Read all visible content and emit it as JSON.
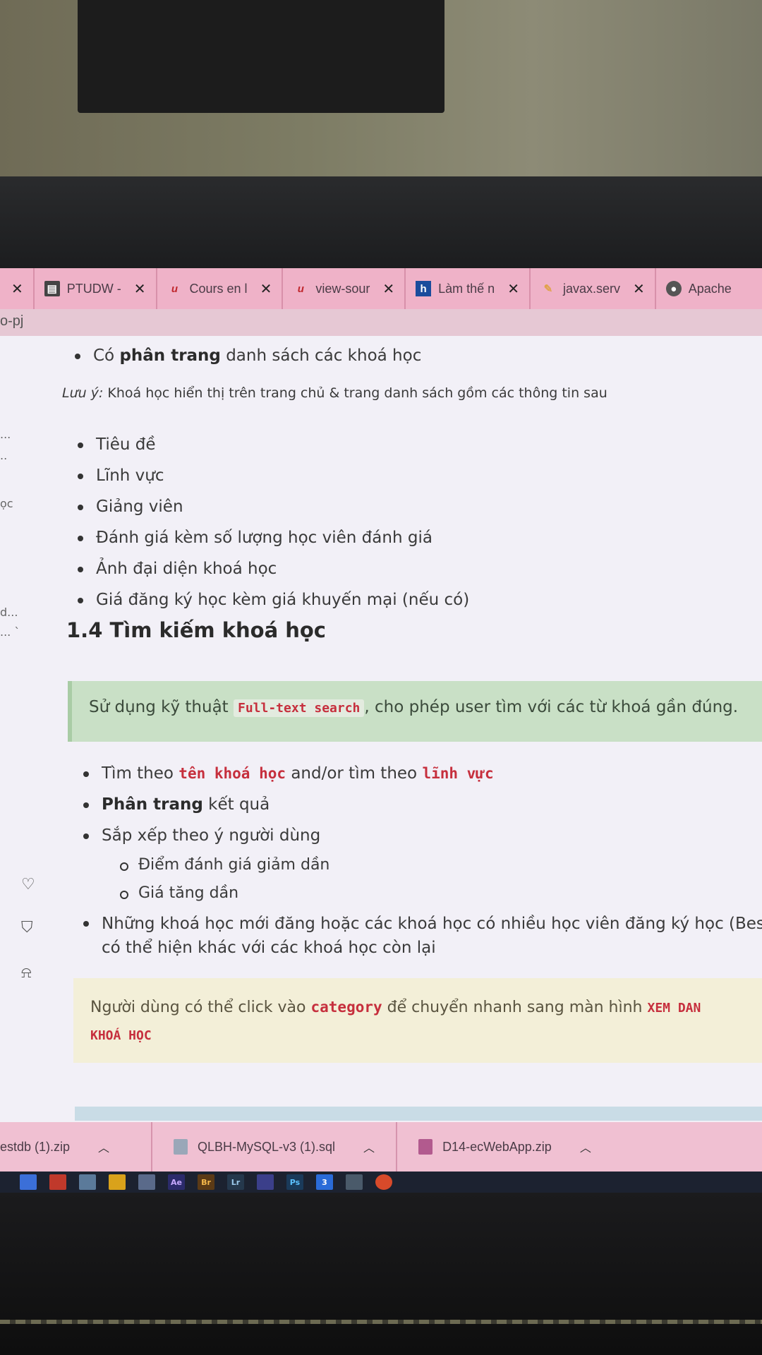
{
  "browser": {
    "tabs": [
      {
        "title": "PTUDW -",
        "icon": "document-icon"
      },
      {
        "title": "Cours en l",
        "icon": "udemy-icon"
      },
      {
        "title": "view-sour",
        "icon": "udemy-icon"
      },
      {
        "title": "Làm thế n",
        "icon": "hashnode-icon"
      },
      {
        "title": "javax.serv",
        "icon": "pen-icon"
      },
      {
        "title": "Apache",
        "icon": "globe-icon"
      }
    ],
    "address_fragment": "o-pj"
  },
  "left_rail": {
    "fragments": [
      "...",
      "..",
      "ọc",
      "d...",
      "...  `"
    ]
  },
  "content": {
    "top_bullet": {
      "prefix": "Có ",
      "bold": "phân trang",
      "suffix": " danh sách các khoá học"
    },
    "note_label": "Lưu ý:",
    "note_text": " Khoá học hiển thị trên trang chủ & trang danh sách gồm các thông tin sau",
    "info_items": [
      "Tiêu đề",
      "Lĩnh vực",
      "Giảng viên",
      "Đánh giá kèm số lượng học viên đánh giá",
      "Ảnh đại diện khoá học",
      "Giá đăng ký học kèm giá khuyến mại (nếu có)"
    ],
    "section_heading": "1.4 Tìm kiếm khoá học",
    "success_note": {
      "before": "Sử dụng kỹ thuật ",
      "code": "Full-text search",
      "after": ", cho phép user tìm với các từ khoá gần đúng."
    },
    "search_bullet": {
      "text1": "Tìm theo ",
      "kw1": "tên khoá học",
      "text2": " and/or tìm theo ",
      "kw2": "lĩnh vực"
    },
    "paging_bullet": {
      "bold": "Phân trang",
      "suffix": " kết quả"
    },
    "sort_bullet": "Sắp xếp theo ý người dùng",
    "sort_items": [
      "Điểm đánh giá giảm dần",
      "Giá tăng dần"
    ],
    "new_courses_bullet": "Những khoá học mới đăng hoặc các khoá học có nhiều học viên đăng ký học (Best S",
    "new_courses_cont": "có thể hiện khác với các khoá học còn lại",
    "warning_note": {
      "before": "Người dùng có thể click vào ",
      "kw": "category",
      "after": " để chuyển nhanh sang màn hình ",
      "kw2a": "XEM DAN",
      "kw2b": "KHOÁ HỌC"
    }
  },
  "downloads": [
    {
      "name": "estdb (1).zip"
    },
    {
      "name": "QLBH-MySQL-v3 (1).sql"
    },
    {
      "name": "D14-ecWebApp.zip"
    }
  ],
  "taskbar": {
    "apps": [
      {
        "label": "",
        "icon": "start-icon",
        "color": "#3b6fd8"
      },
      {
        "label": "",
        "icon": "security-icon",
        "color": "#c0392b"
      },
      {
        "label": "",
        "icon": "paint-icon",
        "color": "#5b7a9a"
      },
      {
        "label": "",
        "icon": "folder-icon",
        "color": "#d9a21b"
      },
      {
        "label": "",
        "icon": "apps-icon",
        "color": "#5a6a8a"
      },
      {
        "label": "Ae",
        "icon": "after-effects-icon",
        "color": "#2b2b6b"
      },
      {
        "label": "Br",
        "icon": "bridge-icon",
        "color": "#5b3a16"
      },
      {
        "label": "Lr",
        "icon": "lightroom-icon",
        "color": "#25384c"
      },
      {
        "label": "",
        "icon": "media-icon",
        "color": "#3b3f8a"
      },
      {
        "label": "Ps",
        "icon": "photoshop-icon",
        "color": "#1a3a5a"
      },
      {
        "label": "3",
        "icon": "app-3-icon",
        "color": "#2a6bd8"
      },
      {
        "label": "",
        "icon": "tool-icon",
        "color": "#4a5a6a"
      },
      {
        "label": "",
        "icon": "chrome-icon",
        "color": "#d84a2a"
      }
    ]
  }
}
